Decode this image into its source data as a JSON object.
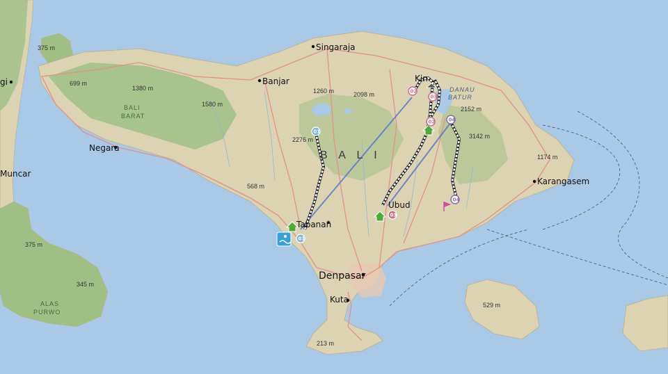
{
  "colors": {
    "sea": "#a9c9e6",
    "land": "#dcd3b3",
    "forest": "#9fbf84",
    "road": "#e2918a",
    "route_straight": "#5a78c8",
    "route_dotted": "#ffffff",
    "stage_blue": "#7fb6df",
    "stage_pink": "#c9708a",
    "stage_purple": "#8a6fae",
    "home_green": "#4faa3a",
    "flag_magenta": "#d04aa8"
  },
  "labels": {
    "island": "B A L I",
    "singaraja": "Singaraja",
    "banjar": "Banjar",
    "negara": "Negara",
    "tabanan": "Tabanan",
    "ubud": "Ubud",
    "denpasar": "Denpasar",
    "kuta": "Kuta",
    "karangasem": "Karangasem",
    "muncar": "Muncar",
    "gi": "gi",
    "bali_barat_1": "BALI",
    "bali_barat_2": "BARAT",
    "alas_1": "ALAS",
    "alas_2": "PURWO",
    "danau_1": "DANAU",
    "danau_2": "BATUR",
    "kin_partial": "Kin"
  },
  "elevations": {
    "e375_top": "375 m",
    "e699": "699 m",
    "e1380": "1380 m",
    "e1580": "1580 m",
    "e1260": "1260 m",
    "e2098": "2098 m",
    "e2152": "2152 m",
    "e3142": "3142 m",
    "e2276": "2276 m",
    "e568": "568 m",
    "e1174": "1174 m",
    "e375_left": "375 m",
    "e345": "345 m",
    "e529": "529 m",
    "e213": "213 m"
  },
  "stages": {
    "s01a": "01",
    "s01b": "01",
    "s02a": "02",
    "s02b": "02",
    "s03a": "03",
    "s03b": "03",
    "s04a": "04",
    "s04b": "04"
  }
}
